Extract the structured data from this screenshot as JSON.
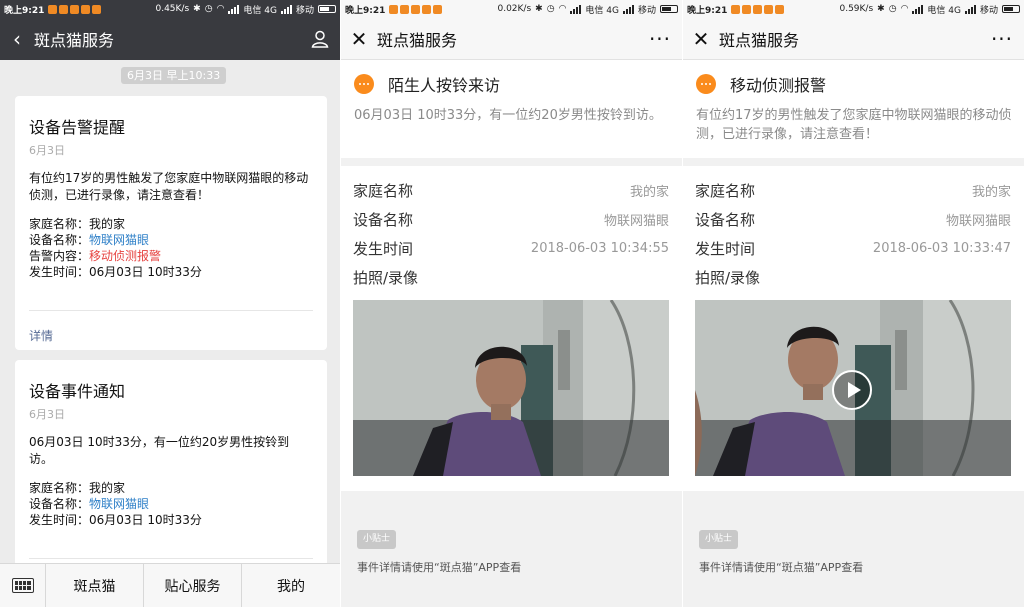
{
  "status_bars": [
    {
      "time": "晚上9:21",
      "speed": "0.45K/s",
      "carrier1": "电信 4G",
      "carrier2": "移动"
    },
    {
      "time": "晚上9:21",
      "speed": "0.02K/s",
      "carrier1": "电信 4G",
      "carrier2": "移动"
    },
    {
      "time": "晚上9:21",
      "speed": "0.59K/s",
      "carrier1": "电信 4G",
      "carrier2": "移动"
    }
  ],
  "chat": {
    "header_title": "斑点猫服务",
    "timestamp": "6月3日 早上10:33",
    "cards": [
      {
        "title": "设备告警提醒",
        "date": "6月3日",
        "body": "有位约17岁的男性触发了您家庭中物联网猫眼的移动侦测，已进行录像，请注意查看！",
        "home_label": "家庭名称：",
        "home_value": "我的家",
        "device_label": "设备名称：",
        "device_value": "物联网猫眼",
        "alert_label": "告警内容：",
        "alert_value": "移动侦测报警",
        "time_label": "发生时间：",
        "time_value": "06月03日 10时33分",
        "detail": "详情"
      },
      {
        "title": "设备事件通知",
        "date": "6月3日",
        "body": "06月03日 10时33分，有一位约20岁男性按铃到访。",
        "home_label": "家庭名称：",
        "home_value": "我的家",
        "device_label": "设备名称：",
        "device_value": "物联网猫眼",
        "time_label": "发生时间：",
        "time_value": "06月03日 10时33分"
      }
    ],
    "bottom_tabs": [
      "斑点猫",
      "贴心服务",
      "我的"
    ]
  },
  "details": [
    {
      "header_title": "斑点猫服务",
      "event_title": "陌生人按铃来访",
      "event_desc": "06月03日 10时33分，有一位约20岁男性按铃到访。",
      "rows": [
        {
          "label": "家庭名称",
          "value": "我的家"
        },
        {
          "label": "设备名称",
          "value": "物联网猫眼"
        },
        {
          "label": "发生时间",
          "value": "2018-06-03 10:34:55"
        },
        {
          "label": "拍照/录像",
          "value": ""
        }
      ],
      "tip_badge": "小贴士",
      "tip_text": "事件详情请使用“斑点猫”APP查看"
    },
    {
      "header_title": "斑点猫服务",
      "event_title": "移动侦测报警",
      "event_desc": "有位约17岁的男性触发了您家庭中物联网猫眼的移动侦测，已进行录像，请注意查看！",
      "rows": [
        {
          "label": "家庭名称",
          "value": "我的家"
        },
        {
          "label": "设备名称",
          "value": "物联网猫眼"
        },
        {
          "label": "发生时间",
          "value": "2018-06-03 10:33:47"
        },
        {
          "label": "拍照/录像",
          "value": ""
        }
      ],
      "tip_badge": "小贴士",
      "tip_text": "事件详情请使用“斑点猫”APP查看"
    }
  ],
  "colors": {
    "header_dark": "#393a3f",
    "link": "#2f80c8",
    "alert": "#e64340",
    "event_icon": "#fa8b1c"
  }
}
